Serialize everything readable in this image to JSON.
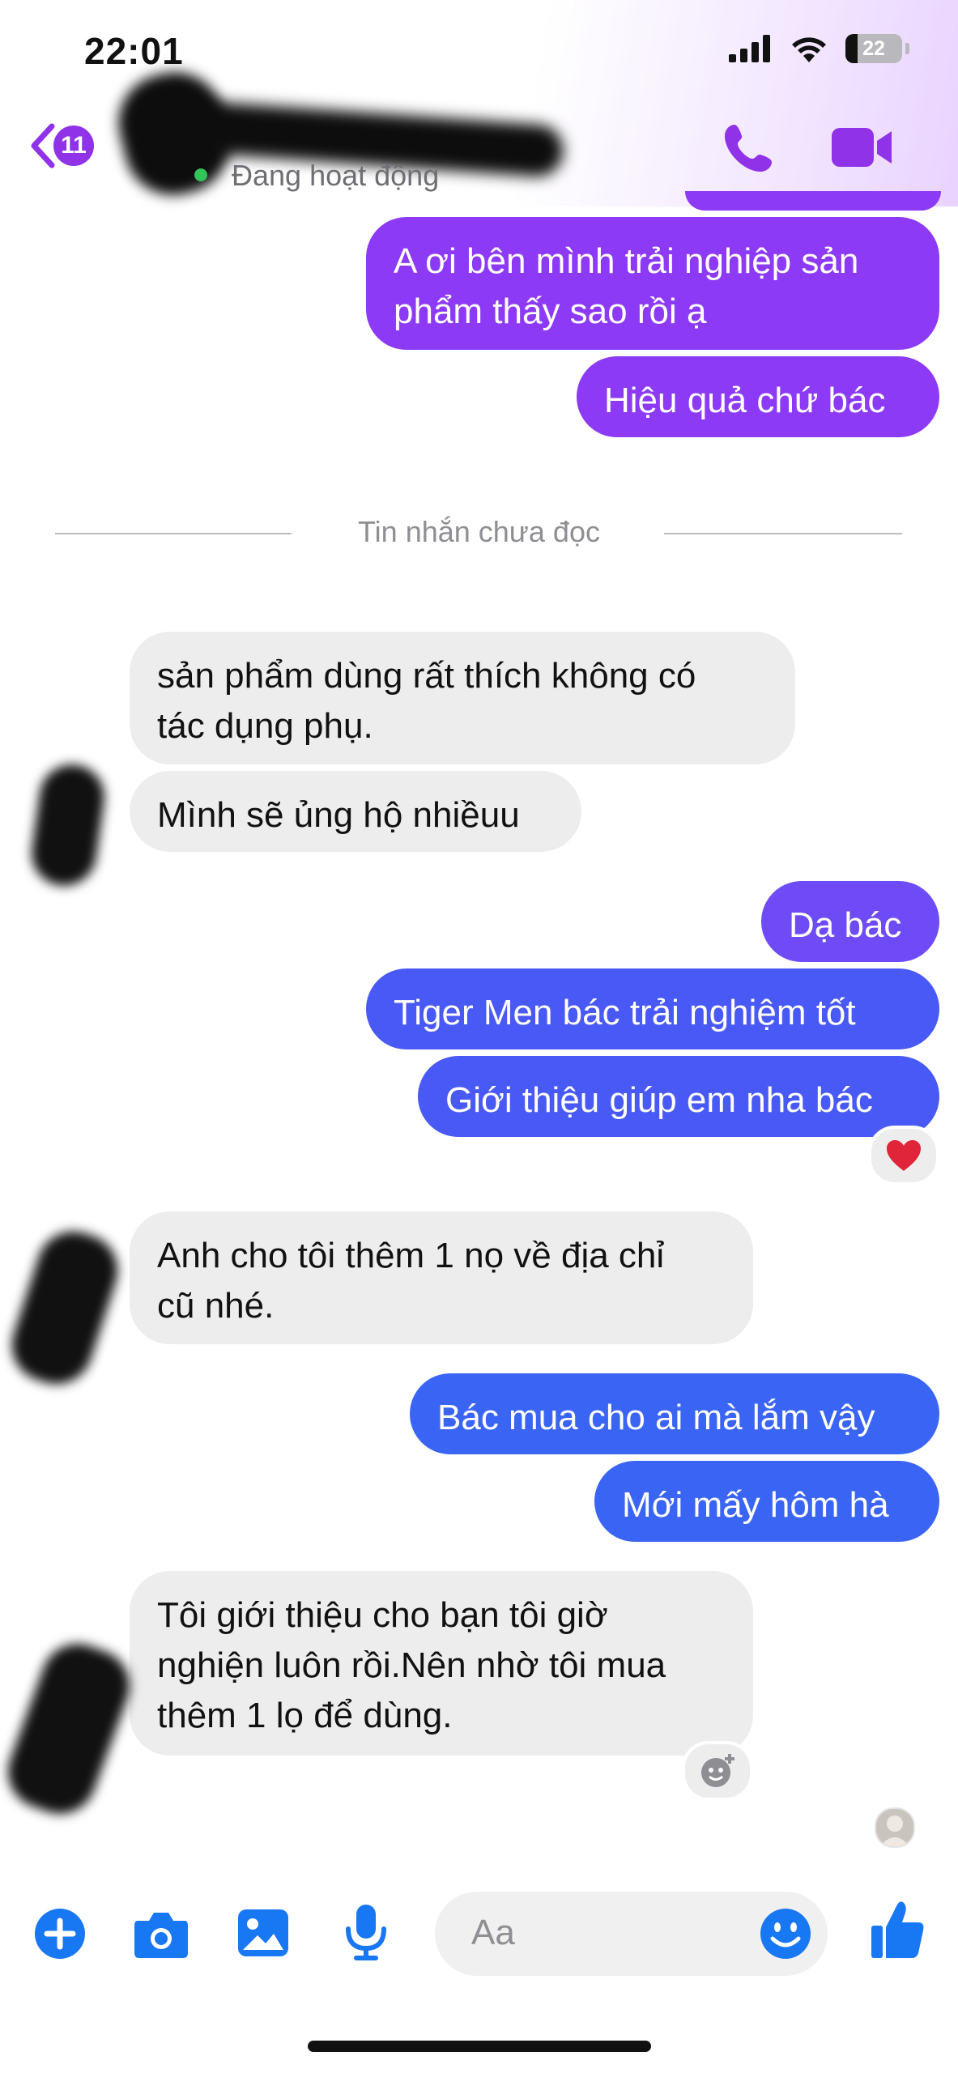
{
  "status_bar": {
    "time": "22:01",
    "battery": "22"
  },
  "header": {
    "back_badge": "11",
    "active_status": "Đang hoạt động",
    "call_icon": "phone-icon",
    "video_icon": "video-camera-icon"
  },
  "divider": {
    "label": "Tin nhắn chưa đọc"
  },
  "messages": [
    {
      "text": "A ơi bên mình trải nghiệp sản\nphẩm thấy sao rồi ạ"
    },
    {
      "text": "Hiệu quả chứ bác"
    },
    {
      "text": "sản phẩm dùng rất thích không có\ntác dụng phụ."
    },
    {
      "text": "Mình sẽ ủng hộ nhiềuu"
    },
    {
      "text": "Dạ bác"
    },
    {
      "text": "Tiger Men bác trải nghiệm tốt"
    },
    {
      "text": "Giới thiệu giúp em nha bác"
    },
    {
      "text": "Anh cho tôi thêm 1 nọ về địa chỉ\ncũ nhé."
    },
    {
      "text": "Bác mua cho ai mà lắm vậy"
    },
    {
      "text": "Mới mấy hôm hà"
    },
    {
      "text": "Tôi giới thiệu cho bạn tôi giờ\nnghiện luôn rồi.Nên nhờ tôi mua\nthêm 1 lọ để dùng."
    }
  ],
  "reactions": {
    "heart": "heart-icon",
    "add_reaction": "add-reaction-icon"
  },
  "composer": {
    "placeholder": "Aa",
    "icons": [
      "plus-icon",
      "camera-icon",
      "image-icon",
      "microphone-icon",
      "emoji-icon",
      "thumbs-up-icon"
    ]
  },
  "colors": {
    "accent_purple": "#8f32e8",
    "bubble_purple": "#8d3af6",
    "bubble_violet": "#6e4bf7",
    "bubble_blue": "#4959f5",
    "composer_blue": "#1877f2",
    "incoming_bubble": "#ededed"
  }
}
